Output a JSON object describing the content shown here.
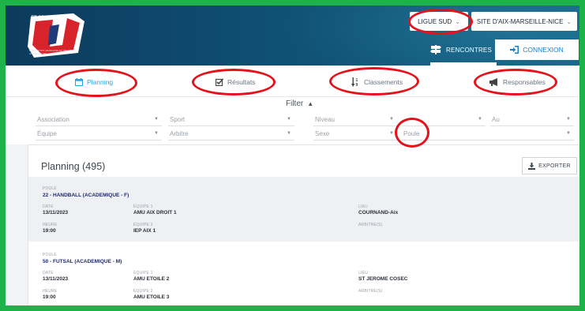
{
  "header": {
    "logo_brand": "FF SPORT U",
    "logo_tagline": "FÉDÉRATION FRANÇAISE DU SPORT UNIVERSITAIRE",
    "ligue": "LIGUE SUD",
    "site": "SITE D'AIX-MARSEILLE-NICE",
    "rencontres_label": "RENCONTRES",
    "connexion_label": "CONNEXION"
  },
  "tabs": [
    {
      "label": "Planning",
      "icon": "calendar-icon",
      "active": true
    },
    {
      "label": "Résultats",
      "icon": "checkbox-icon",
      "active": false
    },
    {
      "label": "Classements",
      "icon": "sort-numeric-icon",
      "active": false
    },
    {
      "label": "Responsables",
      "icon": "megaphone-icon",
      "active": false
    }
  ],
  "filter": {
    "title": "Filter",
    "row1": [
      "Association",
      "Sport",
      "Niveau",
      "",
      "Au"
    ],
    "row2": [
      "Équipe",
      "Arbitre",
      "Sexe",
      "Poule"
    ]
  },
  "planning": {
    "title": "Planning (495)",
    "export_label": "EXPORTER",
    "labels": {
      "poule": "POULE",
      "date": "DATE",
      "heure": "HEURE",
      "equipe1": "ÉQUIPE 1",
      "equipe2": "ÉQUIPE 2",
      "lieu": "LIEU",
      "arbitres": "ARBITRE(S)"
    },
    "entries": [
      {
        "poule": "22 - HANDBALL (ACADEMIQUE - F)",
        "date": "13/11/2023",
        "heure": "19:00",
        "equipe1": "AMU AIX DROIT 1",
        "equipe2": "IEP AIX 1",
        "lieu": "COURNAND-Aix",
        "arbitres": ""
      },
      {
        "poule": "50 - FUTSAL (ACADEMIQUE - M)",
        "date": "13/11/2023",
        "heure": "19:00",
        "equipe1": "AMU ETOILE 2",
        "equipe2": "AMU ETOILE 3",
        "lieu": "ST JEROME COSEC",
        "arbitres": ""
      }
    ]
  },
  "colors": {
    "frame": "#1db24a",
    "header": "#0f4f73",
    "accent": "#2aa3df",
    "annotation": "#e5121b",
    "poule_text": "#1e2a6e"
  }
}
